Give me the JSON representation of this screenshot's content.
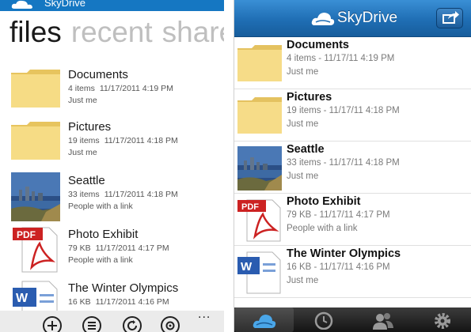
{
  "windows_phone": {
    "app_title": "SkyDrive",
    "pivot": [
      "files",
      "recent",
      "shared"
    ],
    "items": [
      {
        "name": "Documents",
        "count": "4 items",
        "date": "11/17/2011 4:19 PM",
        "shared_with": "Just me",
        "icon": "folder-icon"
      },
      {
        "name": "Pictures",
        "count": "19 items",
        "date": "11/17/2011 4:18 PM",
        "shared_with": "Just me",
        "icon": "folder-icon"
      },
      {
        "name": "Seattle",
        "count": "33 items",
        "date": "11/17/2011 4:18 PM",
        "shared_with": "People with a link",
        "icon": "photo-thumbnail"
      },
      {
        "name": "Photo Exhibit",
        "count": "79 KB",
        "date": "11/17/2011 4:17 PM",
        "shared_with": "People with a link",
        "icon": "pdf-icon"
      },
      {
        "name": "The Winter Olympics",
        "count": "16 KB",
        "date": "11/17/2011 4:16 PM",
        "shared_with": "",
        "icon": "word-doc-icon"
      }
    ],
    "appbar": [
      "add-icon",
      "select-icon",
      "refresh-icon",
      "settings-icon"
    ],
    "more_label": "..."
  },
  "iphone": {
    "app_title": "SkyDrive",
    "items": [
      {
        "name": "Documents",
        "meta": "4 items - 11/17/11 4:19 PM",
        "shared_with": "Just me",
        "icon": "folder-icon"
      },
      {
        "name": "Pictures",
        "meta": "19 items - 11/17/11 4:18 PM",
        "shared_with": "Just me",
        "icon": "folder-icon"
      },
      {
        "name": "Seattle",
        "meta": "33 items - 11/17/11 4:18 PM",
        "shared_with": "Just me",
        "icon": "photo-thumbnail"
      },
      {
        "name": "Photo Exhibit",
        "meta": "79 KB - 11/17/11 4:17 PM",
        "shared_with": "People with a link",
        "icon": "pdf-icon"
      },
      {
        "name": "The Winter Olympics",
        "meta": "16 KB - 11/17/11 4:16 PM",
        "shared_with": "Just me",
        "icon": "word-doc-icon"
      }
    ],
    "tabs": [
      "skydrive-icon",
      "recent-clock-icon",
      "shared-people-icon",
      "settings-gear-icon"
    ],
    "selected_tab": 0
  },
  "colors": {
    "wp_accent": "#1577c2",
    "ios_nav": "#1f6eb4",
    "folder": "#f4d67a"
  },
  "file_type_labels": {
    "pdf": "PDF",
    "word": "W"
  }
}
